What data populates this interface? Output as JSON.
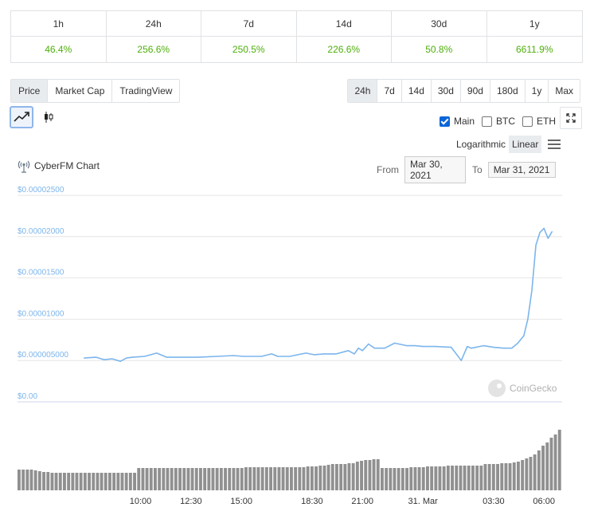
{
  "performance": [
    {
      "period": "1h",
      "value": "46.4%"
    },
    {
      "period": "24h",
      "value": "256.6%"
    },
    {
      "period": "7d",
      "value": "250.5%"
    },
    {
      "period": "14d",
      "value": "226.6%"
    },
    {
      "period": "30d",
      "value": "50.8%"
    },
    {
      "period": "1y",
      "value": "6611.9%"
    }
  ],
  "tabs": [
    {
      "label": "Price",
      "active": true
    },
    {
      "label": "Market Cap",
      "active": false
    },
    {
      "label": "TradingView",
      "active": false
    }
  ],
  "ranges": [
    {
      "label": "24h",
      "active": true
    },
    {
      "label": "7d",
      "active": false
    },
    {
      "label": "14d",
      "active": false
    },
    {
      "label": "30d",
      "active": false
    },
    {
      "label": "90d",
      "active": false
    },
    {
      "label": "180d",
      "active": false
    },
    {
      "label": "1y",
      "active": false
    },
    {
      "label": "Max",
      "active": false
    }
  ],
  "series_toggles": [
    {
      "label": "Main",
      "checked": true
    },
    {
      "label": "BTC",
      "checked": false
    },
    {
      "label": "ETH",
      "checked": false
    }
  ],
  "scale": {
    "log_label": "Logarithmic",
    "linear_label": "Linear",
    "selected": "Linear"
  },
  "chart_title": "CyberFM Chart",
  "date_range": {
    "from_label": "From",
    "from": "Mar 30, 2021",
    "to_label": "To",
    "to": "Mar 31, 2021"
  },
  "watermark": "CoinGecko",
  "colors": {
    "line": "#7cb5ec",
    "gain": "#4eaf0a",
    "volume": "#909090",
    "accent": "#0b65d8"
  },
  "chart_data": {
    "type": "line",
    "ylim": [
      0,
      2.5e-05
    ],
    "yticks": [
      "$0.00",
      "$0.000005000",
      "$0.00001000",
      "$0.00001500",
      "$0.00002000",
      "$0.00002500"
    ],
    "xticks": [
      "10:00",
      "12:30",
      "15:00",
      "18:30",
      "21:00",
      "31. Mar",
      "03:30",
      "06:00"
    ],
    "xtick_hours": [
      10,
      12.5,
      15,
      18.5,
      21,
      24,
      27.5,
      30
    ],
    "series": [
      {
        "name": "Price",
        "x": [
          7.2,
          7.8,
          8.2,
          8.6,
          9.0,
          9.3,
          9.6,
          10.2,
          10.8,
          11.3,
          11.5,
          11.9,
          12.8,
          13.8,
          14.6,
          15.1,
          16.0,
          16.5,
          16.8,
          17.4,
          18.2,
          18.6,
          19.1,
          19.7,
          20.3,
          20.6,
          20.8,
          21.0,
          21.3,
          21.6,
          22.1,
          22.6,
          23.2,
          23.6,
          24.0,
          24.6,
          25.4,
          25.9,
          26.2,
          26.4,
          27.0,
          27.5,
          28.0,
          28.4,
          28.7,
          29.0,
          29.2,
          29.4,
          29.6,
          29.8,
          30.0,
          30.2,
          30.4
        ],
        "y": [
          5.3e-06,
          5.4e-06,
          5.1e-06,
          5.2e-06,
          4.9e-06,
          5.3e-06,
          5.4e-06,
          5.5e-06,
          5.9e-06,
          5.4e-06,
          5.4e-06,
          5.4e-06,
          5.4e-06,
          5.5e-06,
          5.6e-06,
          5.5e-06,
          5.5e-06,
          5.8e-06,
          5.5e-06,
          5.5e-06,
          5.9e-06,
          5.7e-06,
          5.8e-06,
          5.8e-06,
          6.2e-06,
          5.8e-06,
          6.5e-06,
          6.2e-06,
          7e-06,
          6.5e-06,
          6.5e-06,
          7.1e-06,
          6.8e-06,
          6.8e-06,
          6.7e-06,
          6.7e-06,
          6.6e-06,
          5e-06,
          6.7e-06,
          6.5e-06,
          6.8e-06,
          6.6e-06,
          6.5e-06,
          6.5e-06,
          7.1e-06,
          8e-06,
          1e-05,
          1.35e-05,
          1.9e-05,
          2.05e-05,
          2.1e-05,
          1.98e-05,
          2.06e-05
        ]
      },
      {
        "name": "Volume",
        "values": [
          26,
          26,
          26,
          26,
          25,
          24,
          23,
          23,
          22,
          22,
          22,
          22,
          22,
          22,
          22,
          22,
          22,
          22,
          22,
          22,
          22,
          22,
          22,
          22,
          22,
          22,
          22,
          22,
          22,
          28,
          28,
          28,
          28,
          28,
          28,
          28,
          28,
          28,
          28,
          28,
          28,
          28,
          28,
          28,
          28,
          28,
          28,
          28,
          28,
          28,
          28,
          28,
          28,
          28,
          28,
          29,
          29,
          29,
          29,
          29,
          29,
          29,
          29,
          29,
          29,
          29,
          29,
          29,
          29,
          29,
          30,
          30,
          30,
          31,
          31,
          32,
          33,
          33,
          33,
          33,
          34,
          34,
          36,
          37,
          38,
          38,
          39,
          39,
          28,
          28,
          28,
          28,
          28,
          28,
          28,
          29,
          29,
          29,
          29,
          30,
          30,
          30,
          30,
          30,
          31,
          31,
          31,
          31,
          31,
          31,
          31,
          31,
          31,
          33,
          33,
          33,
          33,
          34,
          34,
          34,
          35,
          36,
          38,
          40,
          42,
          45,
          50,
          56,
          60,
          66,
          70,
          76
        ]
      }
    ]
  }
}
